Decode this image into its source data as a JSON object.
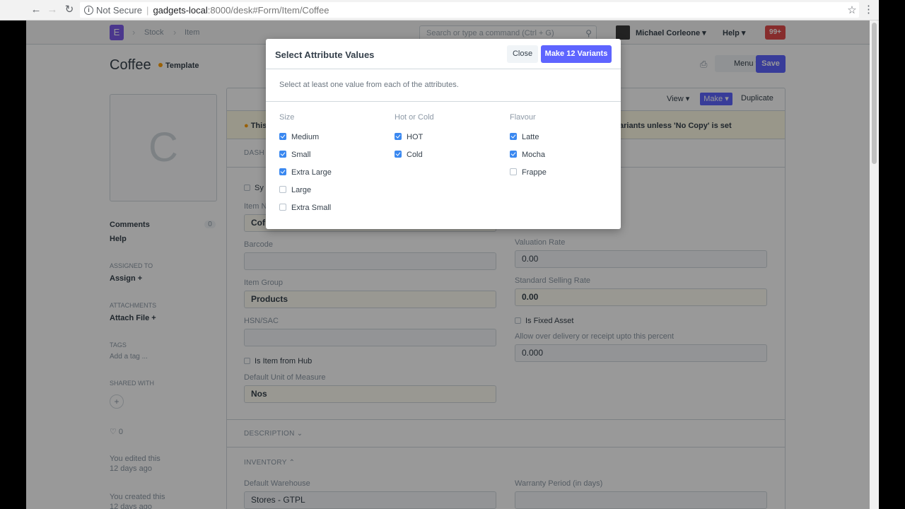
{
  "browser": {
    "not_secure": "Not Secure",
    "url_host": "gadgets-local",
    "url_path": ":8000/desk#Form/Item/Coffee"
  },
  "topnav": {
    "logo": "E",
    "breadcrumbs": [
      "Stock",
      "Item"
    ],
    "search_placeholder": "Search or type a command (Ctrl + G)",
    "user": "Michael Corleone ▾",
    "help": "Help ▾",
    "notifications": "99+"
  },
  "page": {
    "title": "Coffee",
    "indicator": "Template",
    "menu_label": "Menu ▾",
    "save_label": "Save"
  },
  "sidebar": {
    "image_letter": "C",
    "comments_label": "Comments",
    "comments_count": "0",
    "help_label": "Help",
    "assigned_to_heading": "ASSIGNED TO",
    "assign_label": "Assign +",
    "attachments_heading": "ATTACHMENTS",
    "attach_label": "Attach File +",
    "tags_heading": "TAGS",
    "add_tag": "Add a tag ...",
    "shared_heading": "SHARED WITH",
    "likes": "♡ 0",
    "edited_line1": "You edited this",
    "edited_line2": "12 days ago",
    "created_line1": "You created this",
    "created_line2": "12 days ago"
  },
  "form": {
    "toolbar": {
      "view": "View ▾",
      "make": "Make ▾",
      "duplicate": "Duplicate"
    },
    "alert_left": "This",
    "alert_right": "ariants unless 'No Copy' is set",
    "section_dashboard": "DASH",
    "sync_checkbox": "Sy",
    "item_name_label": "Item N",
    "item_name_value": "Cof",
    "barcode_label": "Barcode",
    "item_group_label": "Item Group",
    "item_group_value": "Products",
    "hsn_label": "HSN/SAC",
    "is_item_from_hub": "Is Item from Hub",
    "uom_label": "Default Unit of Measure",
    "uom_value": "Nos",
    "valuation_rate_label": "Valuation Rate",
    "valuation_rate_value": "0.00",
    "selling_rate_label": "Standard Selling Rate",
    "selling_rate_value": "0.00",
    "is_fixed_asset": "Is Fixed Asset",
    "allowance_label": "Allow over delivery or receipt upto this percent",
    "allowance_value": "0.000",
    "section_description": "DESCRIPTION",
    "section_inventory": "INVENTORY",
    "warehouse_label": "Default Warehouse",
    "warehouse_value": "Stores - GTPL",
    "warranty_label": "Warranty Period (in days)"
  },
  "modal": {
    "title": "Select Attribute Values",
    "close_label": "Close",
    "make_variants_label": "Make 12 Variants",
    "description": "Select at least one value from each of the attributes.",
    "attributes": [
      {
        "name": "Size",
        "options": [
          {
            "label": "Medium",
            "checked": true
          },
          {
            "label": "Small",
            "checked": true
          },
          {
            "label": "Extra Large",
            "checked": true
          },
          {
            "label": "Large",
            "checked": false
          },
          {
            "label": "Extra Small",
            "checked": false
          }
        ]
      },
      {
        "name": "Hot or Cold",
        "options": [
          {
            "label": "HOT",
            "checked": true
          },
          {
            "label": "Cold",
            "checked": true
          }
        ]
      },
      {
        "name": "Flavour",
        "options": [
          {
            "label": "Latte",
            "checked": true
          },
          {
            "label": "Mocha",
            "checked": true
          },
          {
            "label": "Frappe",
            "checked": false
          }
        ]
      }
    ]
  },
  "colors": {
    "primary": "#5e64ff",
    "checkbox_checked": "#3a88f0",
    "indicator_orange": "#ffa00a",
    "notification_red": "#e24c4c"
  }
}
